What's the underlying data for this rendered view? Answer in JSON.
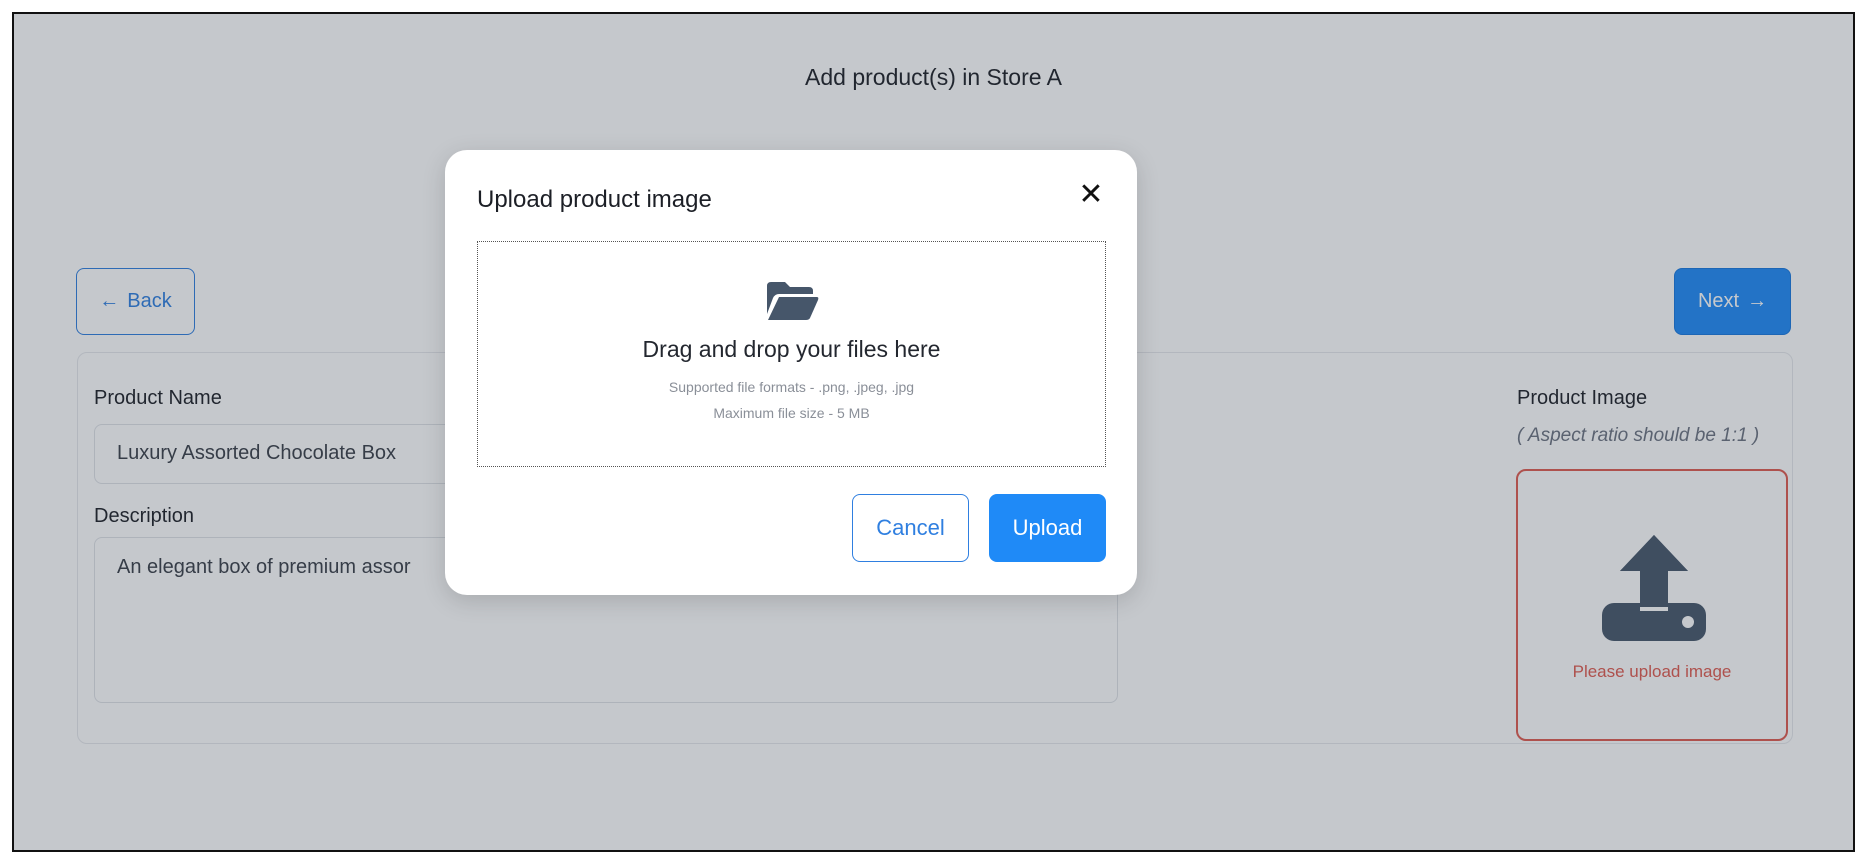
{
  "page": {
    "title": "Add product(s) in Store A",
    "back_label": "Back",
    "next_label": "Next"
  },
  "form": {
    "product_name_label": "Product Name",
    "product_name_value": "Luxury Assorted Chocolate Box",
    "description_label": "Description",
    "description_value": "An elegant box of premium assor",
    "product_image_label": "Product Image",
    "aspect_note": "( Aspect ratio should be 1:1 )",
    "image_error": "Please upload image"
  },
  "modal": {
    "title": "Upload product image",
    "close_glyph": "✕",
    "dropzone_title": "Drag and drop your files here",
    "supported_formats": "Supported file formats - .png, .jpeg, .jpg",
    "max_size": "Maximum file size - 5 MB",
    "cancel_label": "Cancel",
    "upload_label": "Upload"
  },
  "icons": {
    "back": "arrow-left-icon",
    "next": "arrow-right-icon",
    "folder": "folder-icon",
    "upload": "upload-icon",
    "close": "close-icon"
  },
  "colors": {
    "accent": "#1f8af7",
    "error": "#e05a4f",
    "icon_dark": "#46566a",
    "overlay": "rgba(48,56,72,0.28)"
  }
}
